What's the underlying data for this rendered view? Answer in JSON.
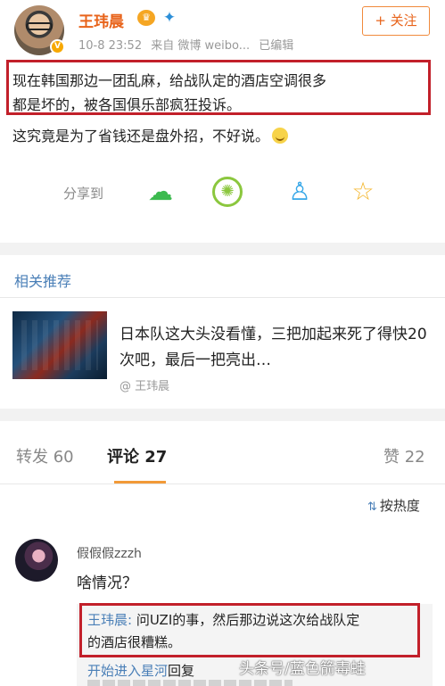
{
  "post": {
    "author": "王玮晨",
    "timestamp": "10-8 23:52",
    "source": "来自 微博 weibo...",
    "edited": "已编辑",
    "follow_label": "+ 关注",
    "body_line1": "现在韩国那边一团乱麻，给战队定的酒店空调很多",
    "body_line2": "都是坏的，被各国俱乐部疯狂投诉。",
    "body_line3": "这究竟是为了省钱还是盘外招，不好说。"
  },
  "share": {
    "label": "分享到",
    "icons": [
      "wechat-icon",
      "moments-icon",
      "qq-icon",
      "qzone-icon"
    ]
  },
  "related": {
    "section_title": "相关推荐",
    "title": "日本队这大头没看懂，三把加起来死了得快20次吧，最后一把亮出…",
    "author": "@ 王玮晨"
  },
  "tabs": {
    "repost": "转发 60",
    "comment": "评论 27",
    "likes": "赞 22"
  },
  "sort_label": "按热度",
  "comment": {
    "user": "假假假zzzh",
    "text": "啥情况？",
    "reply_name": "王玮晨:",
    "reply_text1": " 问UZI的事，然后那边说这次给战队定",
    "reply_text2": "的酒店很糟糕。",
    "reply2_name": "开始进入星河",
    "reply2_text": "回复",
    "watermark": "头条号/蓝色箭毒蛙"
  },
  "colors": {
    "accent_orange": "#e8631a",
    "link_blue": "#4a7fb7",
    "highlight_red": "#c2202a"
  }
}
